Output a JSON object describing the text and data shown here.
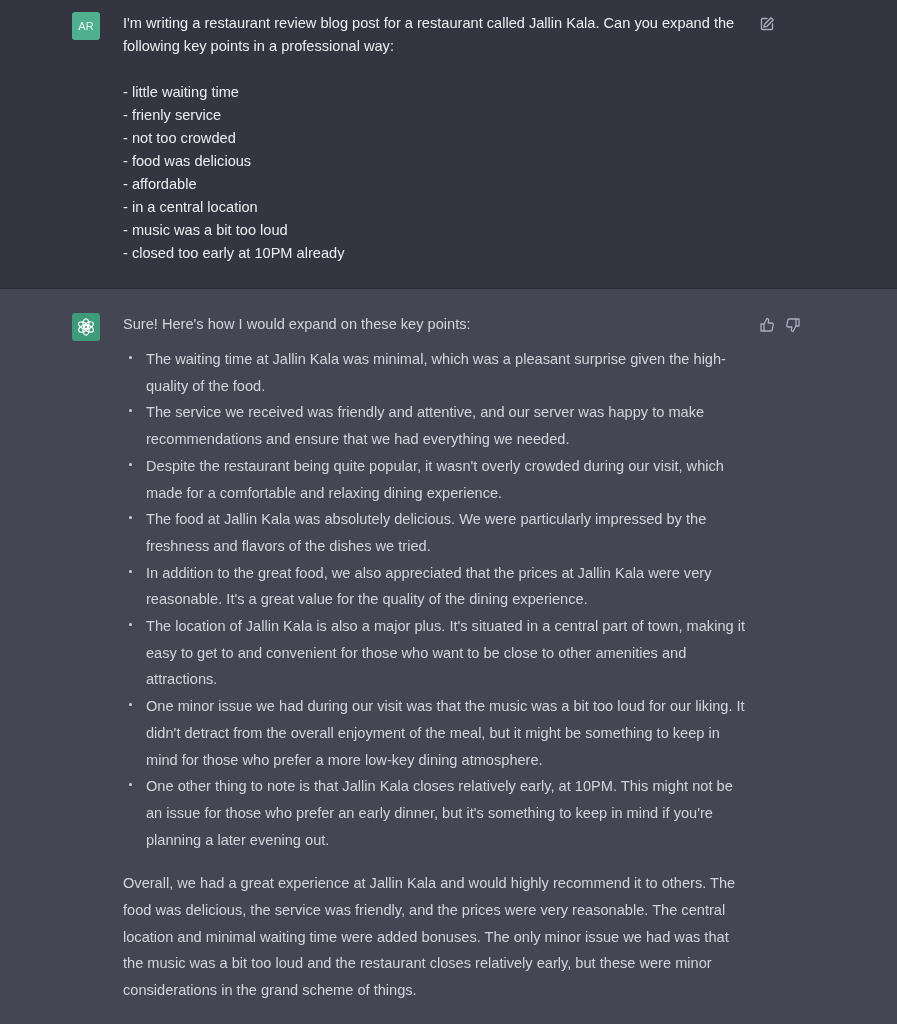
{
  "user_message": {
    "avatar": "AR",
    "intro": "I'm writing a restaurant review blog post for a restaurant called Jallin Kala. Can you expand the following key points in a professional way:",
    "points": [
      "- little waiting time",
      "- frienly service",
      "- not too crowded",
      "- food was delicious",
      "- affordable",
      "- in a central location",
      "- music was a bit too loud",
      "- closed too early at 10PM already"
    ]
  },
  "assistant_message": {
    "intro": "Sure! Here's how I would expand on these key points:",
    "bullets": [
      "The waiting time at Jallin Kala was minimal, which was a pleasant surprise given the high-quality of the food.",
      "The service we received was friendly and attentive, and our server was happy to make recommendations and ensure that we had everything we needed.",
      "Despite the restaurant being quite popular, it wasn't overly crowded during our visit, which made for a comfortable and relaxing dining experience.",
      "The food at Jallin Kala was absolutely delicious. We were particularly impressed by the freshness and flavors of the dishes we tried.",
      "In addition to the great food, we also appreciated that the prices at Jallin Kala were very reasonable. It's a great value for the quality of the dining experience.",
      "The location of Jallin Kala is also a major plus. It's situated in a central part of town, making it easy to get to and convenient for those who want to be close to other amenities and attractions.",
      "One minor issue we had during our visit was that the music was a bit too loud for our liking. It didn't detract from the overall enjoyment of the meal, but it might be something to keep in mind for those who prefer a more low-key dining atmosphere.",
      "One other thing to note is that Jallin Kala closes relatively early, at 10PM. This might not be an issue for those who prefer an early dinner, but it's something to keep in mind if you're planning a later evening out."
    ],
    "conclusion": "Overall, we had a great experience at Jallin Kala and would highly recommend it to others. The food was delicious, the service was friendly, and the prices were very reasonable. The central location and minimal waiting time were added bonuses. The only minor issue we had was that the music was a bit too loud and the restaurant closes relatively early, but these were minor considerations in the grand scheme of things."
  }
}
